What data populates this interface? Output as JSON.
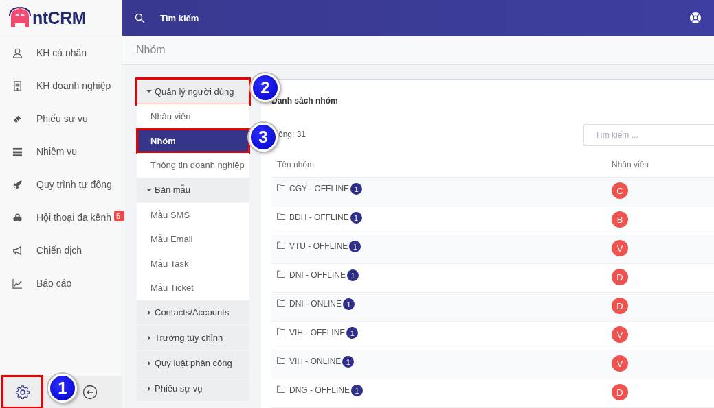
{
  "sidebar": {
    "logo": {
      "suffix": "ntCRM"
    },
    "items": [
      {
        "label": "KH cá nhân"
      },
      {
        "label": "KH doanh nghiệp"
      },
      {
        "label": "Phiếu sự vụ"
      },
      {
        "label": "Nhiệm vụ"
      },
      {
        "label": "Quy trình tự động"
      },
      {
        "label": "Hội thoại đa kênh",
        "badge": "5"
      },
      {
        "label": "Chiến dịch"
      },
      {
        "label": "Báo cáo"
      }
    ],
    "footer": {
      "settings_highlighted": true
    }
  },
  "topbar": {
    "search_label": "Tìm kiếm"
  },
  "page_title": "Nhóm",
  "settings_menu": [
    {
      "label": "Quản lý người dùng",
      "expanded": true,
      "highlighted": true,
      "children": [
        {
          "label": "Nhân viên",
          "selected": false,
          "highlighted": false
        },
        {
          "label": "Nhóm",
          "selected": true,
          "highlighted": true
        },
        {
          "label": "Thông tin doanh nghiệp",
          "selected": false,
          "highlighted": false
        }
      ]
    },
    {
      "label": "Bản mẫu",
      "expanded": true,
      "highlighted": false,
      "children": [
        {
          "label": "Mẫu SMS",
          "selected": false,
          "highlighted": false
        },
        {
          "label": "Mẫu Email",
          "selected": false,
          "highlighted": false
        },
        {
          "label": "Mẫu Task",
          "selected": false,
          "highlighted": false
        },
        {
          "label": "Mẫu Ticket",
          "selected": false,
          "highlighted": false
        }
      ]
    },
    {
      "label": "Contacts/Accounts",
      "expanded": false,
      "highlighted": false
    },
    {
      "label": "Trường tùy chỉnh",
      "expanded": false,
      "highlighted": false
    },
    {
      "label": "Quy luật phân công",
      "expanded": false,
      "highlighted": false
    },
    {
      "label": "Phiếu sự vụ",
      "expanded": false,
      "highlighted": false
    }
  ],
  "card": {
    "title": "Danh sách nhóm",
    "total": "ổng: 31",
    "search_placeholder": "Tìm kiếm ...",
    "columns": [
      "Tên nhóm",
      "Nhân viên"
    ],
    "rows": [
      {
        "name": "CGY - OFFLINE",
        "count": "1",
        "avatar": "C"
      },
      {
        "name": "BDH - OFFLINE",
        "count": "1",
        "avatar": "B"
      },
      {
        "name": "VTU - OFFLINE",
        "count": "1",
        "avatar": "V"
      },
      {
        "name": "DNI - OFFLINE",
        "count": "1",
        "avatar": "D"
      },
      {
        "name": "DNI - ONLINE",
        "count": "1",
        "avatar": "D"
      },
      {
        "name": "VIH - OFFLINE",
        "count": "1",
        "avatar": "V"
      },
      {
        "name": "VIH - ONLINE",
        "count": "1",
        "avatar": "V"
      },
      {
        "name": "DNG - OFFLINE",
        "count": "1",
        "avatar": "D"
      }
    ]
  },
  "callouts": [
    "1",
    "2",
    "3"
  ]
}
